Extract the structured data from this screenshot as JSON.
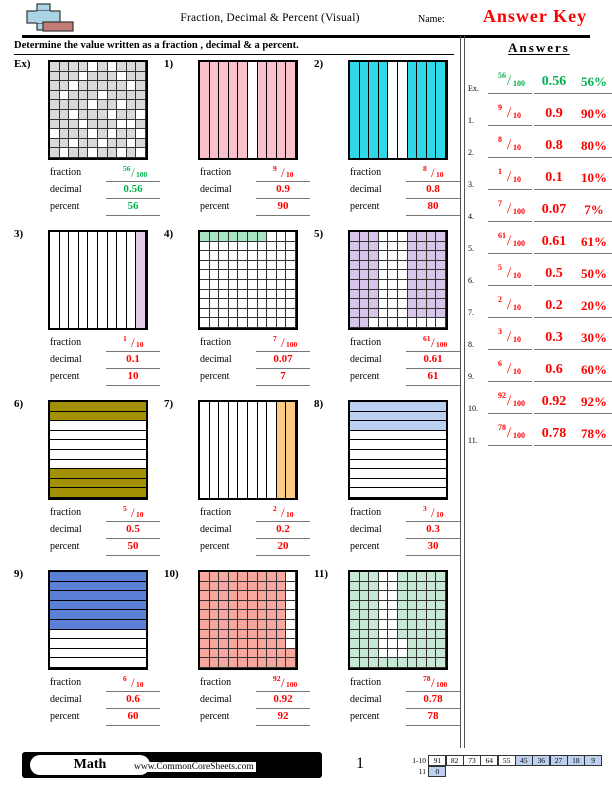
{
  "header": {
    "title": "Fraction, Decimal & Percent (Visual)",
    "name_label": "Name:",
    "answer_key": "Answer Key",
    "logo_icon": "plus-block-logo"
  },
  "instruction": "Determine the value written as a fraction , decimal & a percent.",
  "labels": {
    "fraction": "fraction",
    "decimal": "decimal",
    "percent": "percent"
  },
  "answers_panel": {
    "title": "Answers",
    "rows": [
      {
        "num": "Ex.",
        "numerator": "56",
        "denominator": "100",
        "decimal": "0.56",
        "percent": "56%",
        "color": "#00b14f"
      },
      {
        "num": "1.",
        "numerator": "9",
        "denominator": "10",
        "decimal": "0.9",
        "percent": "90%",
        "color": "#ff0000"
      },
      {
        "num": "2.",
        "numerator": "8",
        "denominator": "10",
        "decimal": "0.8",
        "percent": "80%",
        "color": "#ff0000"
      },
      {
        "num": "3.",
        "numerator": "1",
        "denominator": "10",
        "decimal": "0.1",
        "percent": "10%",
        "color": "#ff0000"
      },
      {
        "num": "4.",
        "numerator": "7",
        "denominator": "100",
        "decimal": "0.07",
        "percent": "7%",
        "color": "#ff0000"
      },
      {
        "num": "5.",
        "numerator": "61",
        "denominator": "100",
        "decimal": "0.61",
        "percent": "61%",
        "color": "#ff0000"
      },
      {
        "num": "6.",
        "numerator": "5",
        "denominator": "10",
        "decimal": "0.5",
        "percent": "50%",
        "color": "#ff0000"
      },
      {
        "num": "7.",
        "numerator": "2",
        "denominator": "10",
        "decimal": "0.2",
        "percent": "20%",
        "color": "#ff0000"
      },
      {
        "num": "8.",
        "numerator": "3",
        "denominator": "10",
        "decimal": "0.3",
        "percent": "30%",
        "color": "#ff0000"
      },
      {
        "num": "9.",
        "numerator": "6",
        "denominator": "10",
        "decimal": "0.6",
        "percent": "60%",
        "color": "#ff0000"
      },
      {
        "num": "10.",
        "numerator": "92",
        "denominator": "100",
        "decimal": "0.92",
        "percent": "92%",
        "color": "#ff0000"
      },
      {
        "num": "11.",
        "numerator": "78",
        "denominator": "100",
        "decimal": "0.78",
        "percent": "78%",
        "color": "#ff0000"
      }
    ]
  },
  "problems": [
    {
      "label": "Ex)",
      "grid": "100",
      "color": "#d9d9d9",
      "shaded": 56,
      "is_example": true,
      "numerator": "56",
      "denominator": "100",
      "decimal": "0.56",
      "percent": "56",
      "pattern": [
        1,
        1,
        1,
        1,
        0,
        1,
        0,
        1,
        1,
        1,
        1,
        1,
        1,
        0,
        1,
        1,
        1,
        0,
        1,
        1,
        1,
        1,
        0,
        1,
        1,
        1,
        1,
        1,
        0,
        1,
        1,
        0,
        1,
        1,
        1,
        0,
        1,
        1,
        1,
        1,
        1,
        1,
        1,
        1,
        0,
        1,
        1,
        0,
        1,
        1,
        1,
        1,
        0,
        1,
        1,
        1,
        0,
        1,
        1,
        0,
        1,
        1,
        1,
        0,
        1,
        1,
        1,
        0,
        0,
        1,
        0,
        1,
        1,
        1,
        0,
        1,
        0,
        1,
        1,
        0,
        1,
        1,
        0,
        1,
        1,
        0,
        1,
        1,
        0,
        1,
        1,
        0,
        1,
        1,
        0,
        1,
        1,
        0,
        1,
        0
      ]
    },
    {
      "label": "1)",
      "grid": "10c",
      "color": "#fac0cb",
      "shaded": 9,
      "is_example": false,
      "numerator": "9",
      "denominator": "10",
      "decimal": "0.9",
      "percent": "90",
      "pattern": [
        1,
        1,
        1,
        1,
        1,
        0,
        1,
        1,
        1,
        1
      ]
    },
    {
      "label": "2)",
      "grid": "10c",
      "color": "#2ed8e8",
      "shaded": 8,
      "is_example": false,
      "numerator": "8",
      "denominator": "10",
      "decimal": "0.8",
      "percent": "80",
      "pattern": [
        1,
        1,
        1,
        1,
        0,
        0,
        1,
        1,
        1,
        1
      ]
    },
    {
      "label": "3)",
      "grid": "10c",
      "color": "#e6cbe8",
      "shaded": 1,
      "is_example": false,
      "numerator": "1",
      "denominator": "10",
      "decimal": "0.1",
      "percent": "10",
      "pattern": [
        0,
        0,
        0,
        0,
        0,
        0,
        0,
        0,
        0,
        1
      ]
    },
    {
      "label": "4)",
      "grid": "100",
      "color": "#a8e6c3",
      "shaded": 7,
      "is_example": false,
      "numerator": "7",
      "denominator": "100",
      "decimal": "0.07",
      "percent": "7",
      "pattern": [
        1,
        1,
        1,
        1,
        1,
        1,
        1,
        0,
        0,
        0,
        0,
        0,
        0,
        0,
        0,
        0,
        0,
        0,
        0,
        0,
        0,
        0,
        0,
        0,
        0,
        0,
        0,
        0,
        0,
        0,
        0,
        0,
        0,
        0,
        0,
        0,
        0,
        0,
        0,
        0,
        0,
        0,
        0,
        0,
        0,
        0,
        0,
        0,
        0,
        0,
        0,
        0,
        0,
        0,
        0,
        0,
        0,
        0,
        0,
        0,
        0,
        0,
        0,
        0,
        0,
        0,
        0,
        0,
        0,
        0,
        0,
        0,
        0,
        0,
        0,
        0,
        0,
        0,
        0,
        0,
        0,
        0,
        0,
        0,
        0,
        0,
        0,
        0,
        0,
        0,
        0,
        0,
        0,
        0,
        0,
        0,
        0,
        0,
        0,
        0
      ]
    },
    {
      "label": "5)",
      "grid": "100",
      "color": "#d7c6ea",
      "shaded": 61,
      "is_example": false,
      "numerator": "61",
      "denominator": "100",
      "decimal": "0.61",
      "percent": "61",
      "pattern": [
        1,
        1,
        1,
        0,
        0,
        0,
        1,
        1,
        1,
        1,
        1,
        1,
        1,
        0,
        0,
        0,
        1,
        1,
        1,
        1,
        1,
        1,
        1,
        0,
        0,
        0,
        1,
        1,
        1,
        1,
        1,
        1,
        1,
        0,
        0,
        0,
        1,
        1,
        1,
        1,
        1,
        1,
        1,
        0,
        0,
        0,
        1,
        1,
        1,
        1,
        1,
        1,
        1,
        0,
        0,
        0,
        1,
        1,
        1,
        1,
        1,
        1,
        1,
        0,
        0,
        0,
        1,
        1,
        1,
        1,
        1,
        1,
        1,
        0,
        0,
        0,
        1,
        1,
        1,
        1,
        1,
        1,
        1,
        0,
        0,
        0,
        1,
        1,
        1,
        1,
        1,
        1,
        0,
        0,
        0,
        0,
        0,
        0,
        0,
        0
      ]
    },
    {
      "label": "6)",
      "grid": "10r",
      "color": "#a39004",
      "shaded": 5,
      "is_example": false,
      "numerator": "5",
      "denominator": "10",
      "decimal": "0.5",
      "percent": "50",
      "pattern": [
        1,
        1,
        0,
        0,
        0,
        0,
        0,
        1,
        1,
        1
      ]
    },
    {
      "label": "7)",
      "grid": "10c",
      "color": "#fbcb83",
      "shaded": 2,
      "is_example": false,
      "numerator": "2",
      "denominator": "10",
      "decimal": "0.2",
      "percent": "20",
      "pattern": [
        0,
        0,
        0,
        0,
        0,
        0,
        0,
        0,
        1,
        1
      ]
    },
    {
      "label": "8)",
      "grid": "10r",
      "color": "#bcd0f2",
      "shaded": 3,
      "is_example": false,
      "numerator": "3",
      "denominator": "10",
      "decimal": "0.3",
      "percent": "30",
      "pattern": [
        1,
        1,
        1,
        0,
        0,
        0,
        0,
        0,
        0,
        0
      ]
    },
    {
      "label": "9)",
      "grid": "10r",
      "color": "#5a7fd4",
      "shaded": 6,
      "is_example": false,
      "numerator": "6",
      "denominator": "10",
      "decimal": "0.6",
      "percent": "60",
      "pattern": [
        1,
        1,
        1,
        1,
        1,
        1,
        0,
        0,
        0,
        0
      ]
    },
    {
      "label": "10)",
      "grid": "100",
      "color": "#f9a8a0",
      "shaded": 92,
      "is_example": false,
      "numerator": "92",
      "denominator": "100",
      "decimal": "0.92",
      "percent": "92",
      "pattern": [
        1,
        1,
        1,
        1,
        1,
        1,
        1,
        1,
        1,
        0,
        1,
        1,
        1,
        1,
        1,
        1,
        1,
        1,
        1,
        0,
        1,
        1,
        1,
        1,
        1,
        1,
        1,
        1,
        1,
        0,
        1,
        1,
        1,
        1,
        1,
        1,
        1,
        1,
        1,
        0,
        1,
        1,
        1,
        1,
        1,
        1,
        1,
        1,
        1,
        0,
        1,
        1,
        1,
        1,
        1,
        1,
        1,
        1,
        1,
        0,
        1,
        1,
        1,
        1,
        1,
        1,
        1,
        1,
        1,
        0,
        1,
        1,
        1,
        1,
        1,
        1,
        1,
        1,
        1,
        0,
        1,
        1,
        1,
        1,
        1,
        1,
        1,
        1,
        1,
        1,
        1,
        1,
        1,
        1,
        1,
        1,
        1,
        1,
        1,
        1
      ]
    },
    {
      "label": "11)",
      "grid": "100",
      "color": "#c6e8d4",
      "shaded": 78,
      "is_example": false,
      "numerator": "78",
      "denominator": "100",
      "decimal": "0.78",
      "percent": "78",
      "pattern": [
        1,
        1,
        1,
        0,
        0,
        1,
        1,
        1,
        1,
        1,
        1,
        1,
        1,
        0,
        0,
        1,
        1,
        1,
        1,
        1,
        1,
        1,
        1,
        0,
        0,
        1,
        1,
        1,
        1,
        1,
        1,
        1,
        1,
        0,
        0,
        1,
        1,
        1,
        1,
        1,
        1,
        1,
        1,
        0,
        0,
        1,
        1,
        1,
        1,
        1,
        1,
        1,
        1,
        0,
        0,
        1,
        1,
        1,
        1,
        1,
        1,
        1,
        1,
        0,
        0,
        1,
        1,
        1,
        1,
        1,
        1,
        1,
        1,
        0,
        0,
        0,
        1,
        1,
        1,
        1,
        1,
        1,
        1,
        0,
        0,
        0,
        1,
        1,
        1,
        1,
        1,
        1,
        1,
        1,
        1,
        1,
        1,
        1,
        1,
        1
      ]
    }
  ],
  "footer": {
    "brand": "Math",
    "url": "www.CommonCoreSheets.com",
    "page_number": "1",
    "score_rows": [
      {
        "label": "1-10",
        "cells": [
          {
            "value": "91",
            "highlighted": false
          },
          {
            "value": "82",
            "highlighted": false
          },
          {
            "value": "73",
            "highlighted": false
          },
          {
            "value": "64",
            "highlighted": false
          },
          {
            "value": "55",
            "highlighted": false
          },
          {
            "value": "45",
            "highlighted": true
          },
          {
            "value": "36",
            "highlighted": true
          },
          {
            "value": "27",
            "highlighted": true
          },
          {
            "value": "18",
            "highlighted": true
          },
          {
            "value": "9",
            "highlighted": true
          }
        ]
      },
      {
        "label": "11",
        "cells": [
          {
            "value": "0",
            "highlighted": true
          }
        ]
      }
    ]
  }
}
